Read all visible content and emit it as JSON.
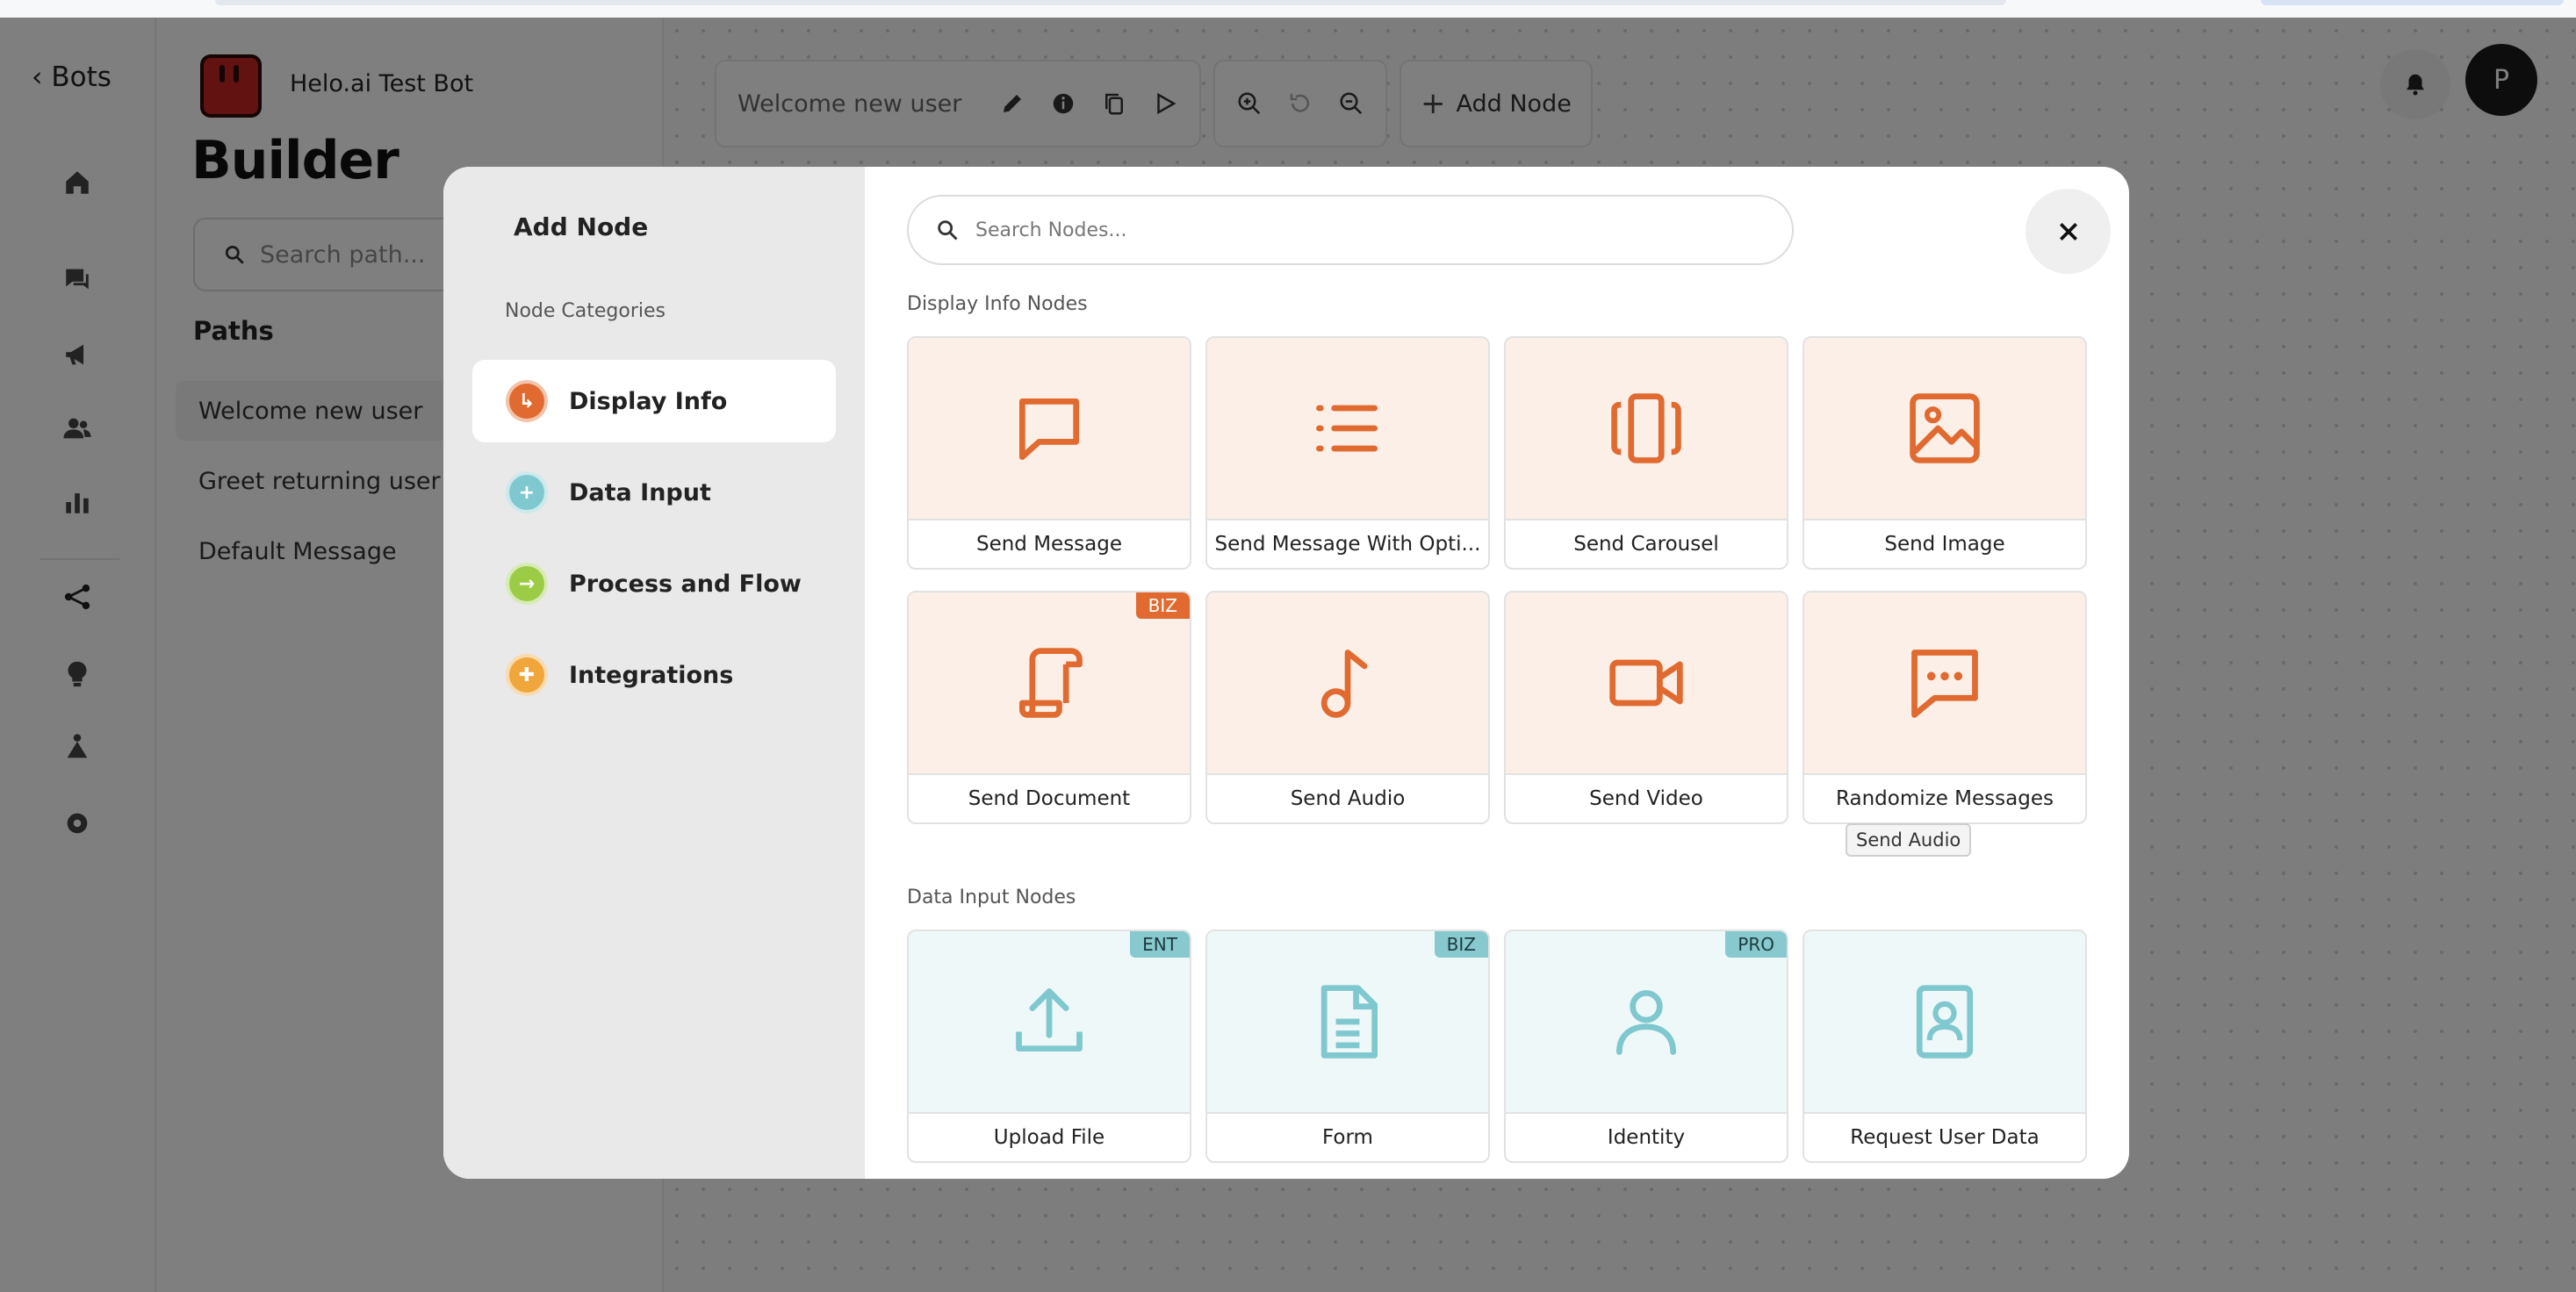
{
  "nav": {
    "back_label": "Bots"
  },
  "bot": {
    "name": "Helo.ai Test Bot"
  },
  "panel": {
    "title": "Builder",
    "search_placeholder": "Search path...",
    "paths_heading": "Paths",
    "paths": [
      "Welcome new user",
      "Greet returning user",
      "Default Message"
    ],
    "active_path": "Welcome new user"
  },
  "toolbar": {
    "path_name": "Welcome new user",
    "add_node_label": "Add Node"
  },
  "user": {
    "avatar_initial": "P"
  },
  "modal": {
    "title": "Add Node",
    "categories_heading": "Node Categories",
    "categories": [
      {
        "label": "Display Info",
        "color": "#e06a2f",
        "icon": "corner-arrow-icon"
      },
      {
        "label": "Data Input",
        "color": "#7fc8cf",
        "icon": "plus-icon"
      },
      {
        "label": "Process and Flow",
        "color": "#9ccc45",
        "icon": "arrow-right-icon"
      },
      {
        "label": "Integrations",
        "color": "#f0a63a",
        "icon": "puzzle-icon"
      }
    ],
    "search_placeholder": "Search Nodes...",
    "display_section": "Display Info Nodes",
    "display_nodes": [
      {
        "label": "Send Message",
        "icon": "message-icon",
        "badge": ""
      },
      {
        "label": "Send Message With Opti...",
        "icon": "list-icon",
        "badge": ""
      },
      {
        "label": "Send Carousel",
        "icon": "carousel-icon",
        "badge": ""
      },
      {
        "label": "Send Image",
        "icon": "image-icon",
        "badge": ""
      },
      {
        "label": "Send Document",
        "icon": "document-scroll-icon",
        "badge": "BIZ"
      },
      {
        "label": "Send Audio",
        "icon": "music-note-icon",
        "badge": ""
      },
      {
        "label": "Send Video",
        "icon": "video-icon",
        "badge": ""
      },
      {
        "label": "Randomize Messages",
        "icon": "chat-dots-icon",
        "badge": ""
      }
    ],
    "input_section": "Data Input Nodes",
    "input_nodes": [
      {
        "label": "Upload File",
        "icon": "upload-icon",
        "badge": "ENT"
      },
      {
        "label": "Form",
        "icon": "form-icon",
        "badge": "BIZ"
      },
      {
        "label": "Identity",
        "icon": "user-icon",
        "badge": "PRO"
      },
      {
        "label": "Request User Data",
        "icon": "contact-card-icon",
        "badge": ""
      }
    ],
    "tooltip": "Send Audio"
  },
  "colors": {
    "accent_orange": "#e06a2f",
    "accent_teal": "#7fc8cf"
  }
}
